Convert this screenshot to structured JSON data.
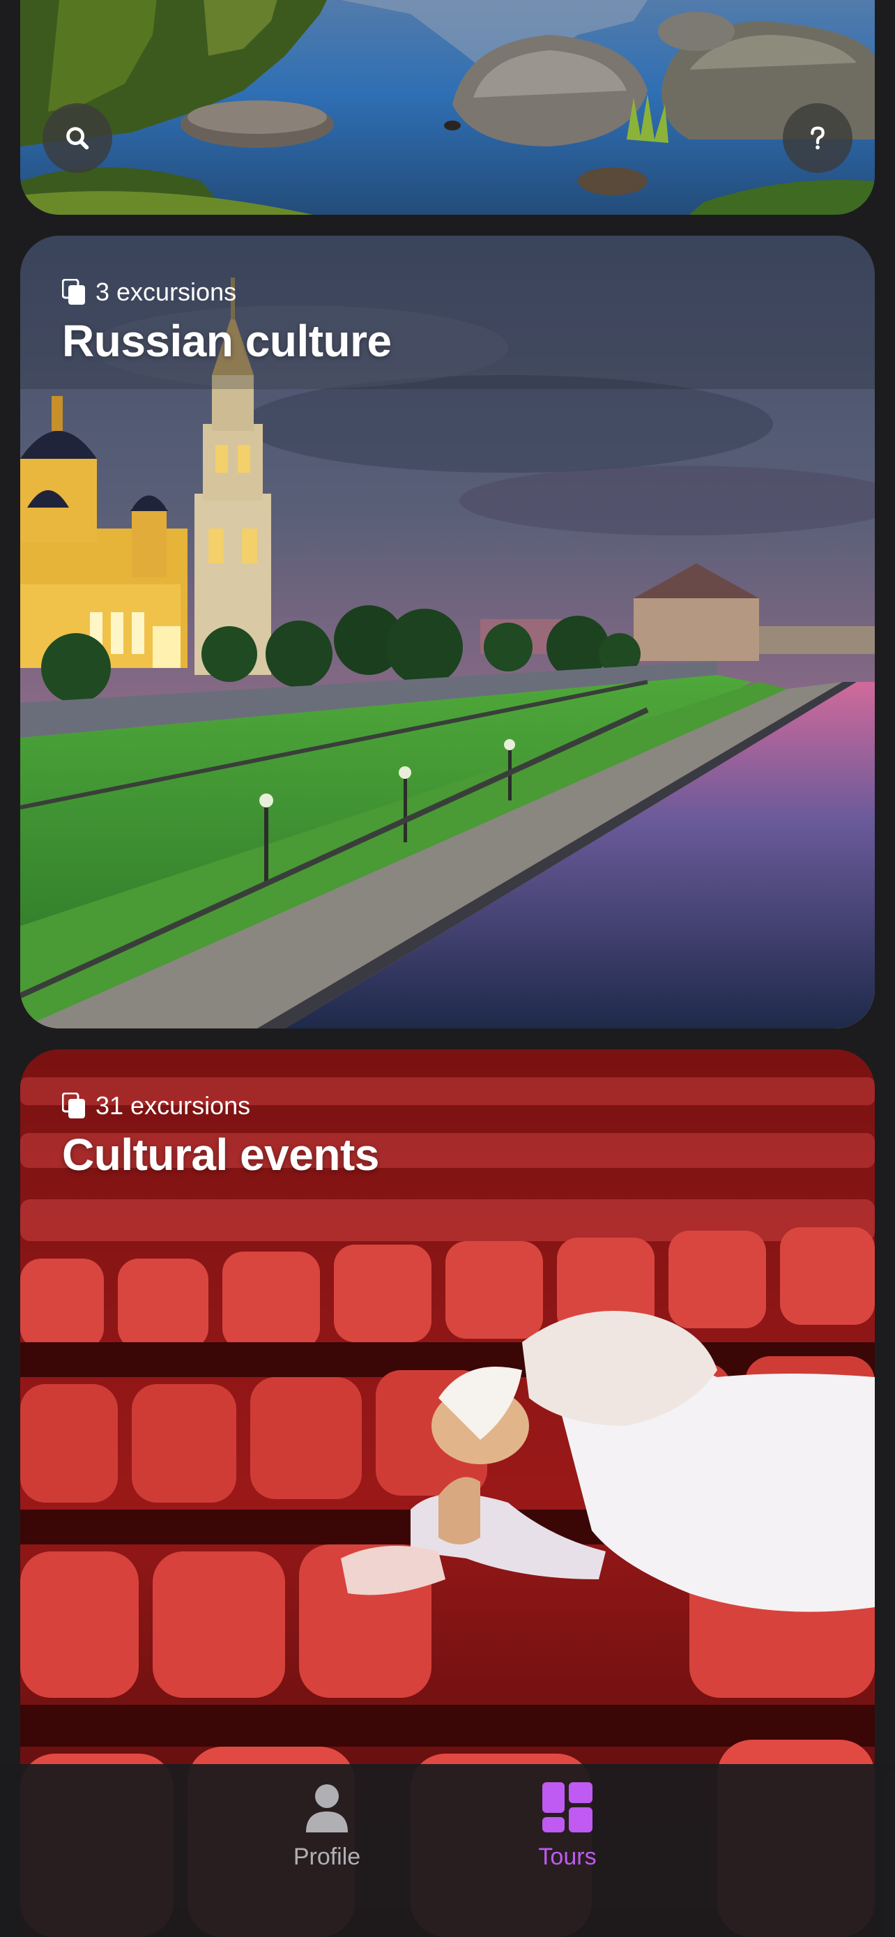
{
  "top_card": {
    "search_icon": "search-icon",
    "help_icon": "question-mark-icon"
  },
  "cards": [
    {
      "count_label": "3 excursions",
      "title": "Russian culture",
      "icon": "stack-icon"
    },
    {
      "count_label": "31 excursions",
      "title": "Cultural events",
      "icon": "stack-icon"
    }
  ],
  "tabbar": {
    "tabs": [
      {
        "label": "Profile",
        "icon": "person-icon",
        "active": false
      },
      {
        "label": "Tours",
        "icon": "grid-icon",
        "active": true
      }
    ]
  },
  "colors": {
    "background": "#1c1c1e",
    "accent": "#bf5af2",
    "inactive_tab": "#b0b0b4"
  }
}
